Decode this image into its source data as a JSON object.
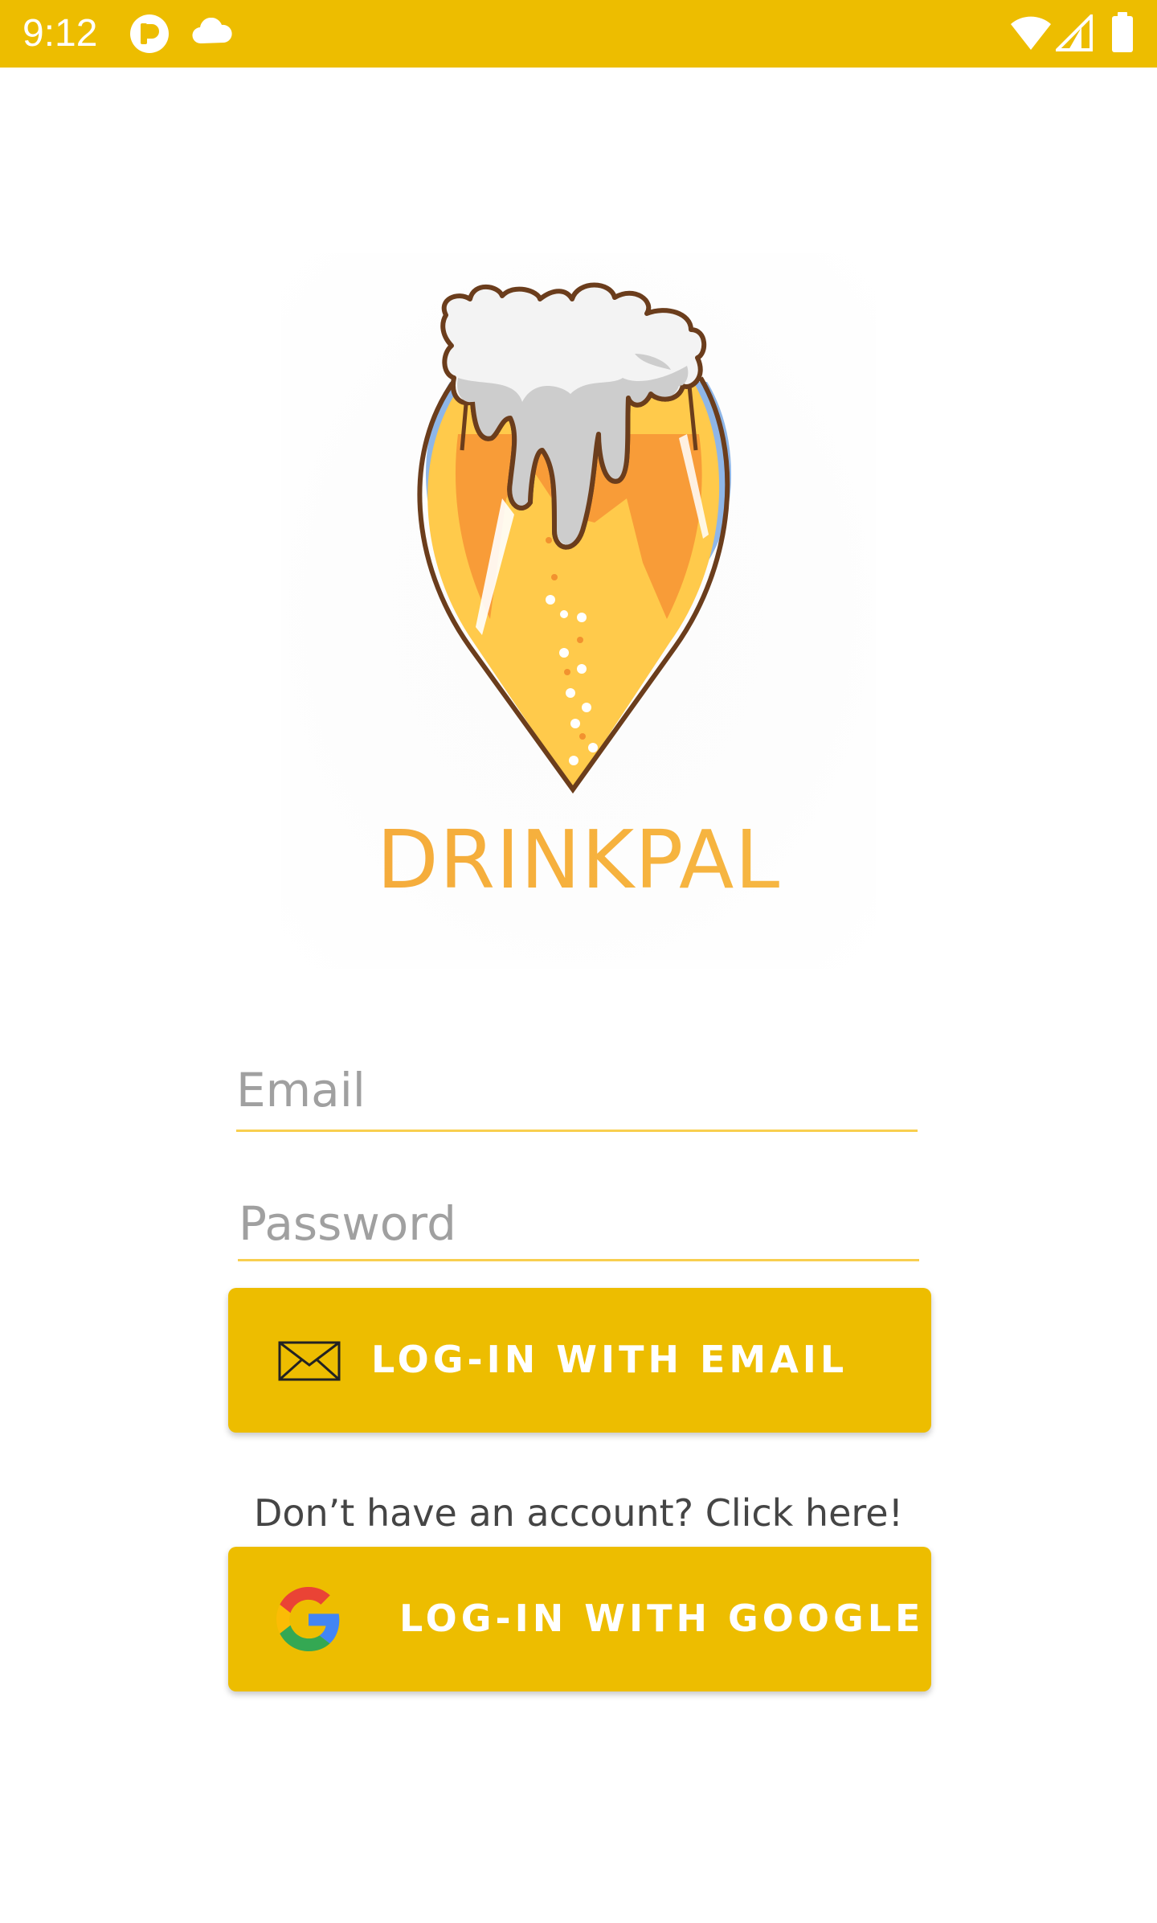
{
  "status_bar": {
    "time": "9:12"
  },
  "app": {
    "name": "DRINKPAL"
  },
  "form": {
    "email_placeholder": "Email",
    "email_value": "",
    "password_placeholder": "Password",
    "password_value": ""
  },
  "buttons": {
    "email_login_label": "LOG-IN WITH EMAIL",
    "google_login_label": "LOG-IN WITH GOOGLE"
  },
  "links": {
    "signup_text": "Don’t have an account? Click here!"
  },
  "colors": {
    "primary": "#EDBD00",
    "brand_text": "#F3A83C",
    "field_underline": "#F8CF4F"
  },
  "icons": {
    "logo": "beer-glass-pin-logo",
    "email_button": "envelope-icon",
    "google_button": "google-g-icon"
  }
}
